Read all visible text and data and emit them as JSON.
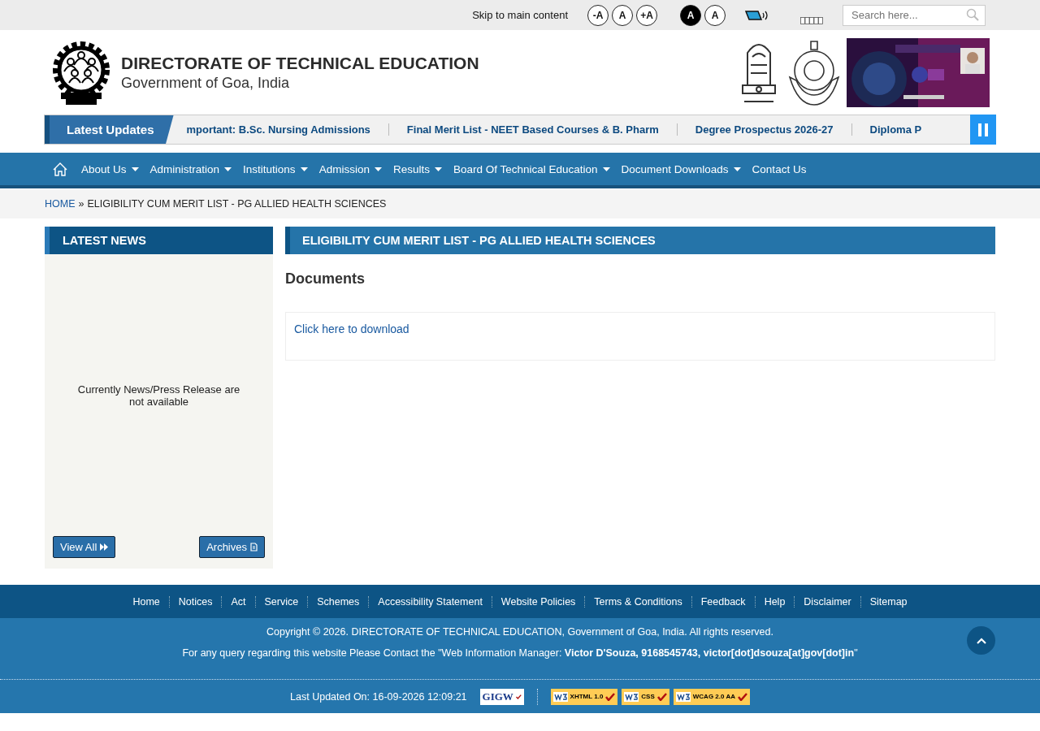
{
  "top_bar": {
    "skip_link": "Skip to main content",
    "font_size_buttons": [
      "-A",
      "A",
      "+A"
    ],
    "contrast_buttons": [
      {
        "label": "A",
        "selected": true
      },
      {
        "label": "A",
        "selected": false
      }
    ],
    "search": {
      "placeholder": "Search here..."
    }
  },
  "header": {
    "title": "DIRECTORATE OF TECHNICAL EDUCATION",
    "subtitle": "Government of Goa, India"
  },
  "ticker": {
    "label": "Latest Updates",
    "items": [
      "mportant: B.Sc. Nursing Admissions",
      "Final Merit List - NEET Based Courses & B. Pharm",
      "Degree Prospectus 2026-27",
      "Diploma P"
    ]
  },
  "nav": {
    "items": [
      {
        "label": "About Us",
        "has_menu": true
      },
      {
        "label": "Administration",
        "has_menu": true
      },
      {
        "label": "Institutions",
        "has_menu": true
      },
      {
        "label": "Admission",
        "has_menu": true
      },
      {
        "label": "Results",
        "has_menu": true
      },
      {
        "label": "Board Of Technical Education",
        "has_menu": true
      },
      {
        "label": "Document Downloads",
        "has_menu": true
      },
      {
        "label": "Contact Us",
        "has_menu": false
      }
    ]
  },
  "breadcrumb": {
    "home": "HOME",
    "separator": "»",
    "current": "ELIGIBILITY CUM MERIT LIST - PG ALLIED HEALTH SCIENCES"
  },
  "sidebar": {
    "title": "LATEST NEWS",
    "message": "Currently News/Press Release are not available",
    "buttons": [
      "View All",
      "Archives"
    ]
  },
  "content": {
    "title": "ELIGIBILITY CUM MERIT LIST - PG ALLIED HEALTH SCIENCES",
    "heading": "Documents",
    "link": "Click here to download"
  },
  "footer": {
    "links": [
      "Home",
      "Notices",
      "Act",
      "Service",
      "Schemes",
      "Accessibility Statement",
      "Website Policies",
      "Terms & Conditions",
      "Feedback",
      "Help",
      "Disclaimer",
      "Sitemap"
    ],
    "copyright": "Copyright © 2026. DIRECTORATE OF TECHNICAL EDUCATION, Government of Goa, India. All rights reserved.",
    "contact": "For any query regarding this website Please Contact the \"Web Information Manager: **Victor D'Souza, 9168545743, victor[dot]dsouza[at]gov[dot]in**\"",
    "last_updated": "Last Updated On: 16-09-2026 12:09:21",
    "badges": [
      {
        "kind": "gigw",
        "label": "GIGW"
      },
      {
        "kind": "w3c",
        "label": "XHTML 1.0"
      },
      {
        "kind": "w3c",
        "label": "CSS"
      },
      {
        "kind": "w3c",
        "label": "WCAG 2.0 AA"
      }
    ]
  }
}
